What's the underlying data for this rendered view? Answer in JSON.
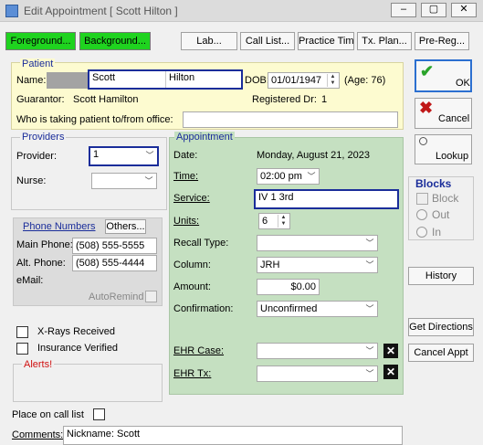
{
  "window": {
    "title": "Edit Appointment [ Scott Hilton ]",
    "minimize": "‒",
    "maximize": "▢",
    "close": "✕"
  },
  "toolbar": {
    "foreground": "Foreground...",
    "background": "Background...",
    "lab": "Lab...",
    "call_list": "Call List...",
    "practice_time": "Practice Time...",
    "tx_plan": "Tx. Plan...",
    "pre_reg": "Pre-Reg..."
  },
  "patient": {
    "group": "Patient",
    "name_label": "Name:",
    "first": "Scott",
    "last": "Hilton",
    "dob_label": "DOB:",
    "dob": "01/01/1947",
    "age": "(Age: 76)",
    "guarantor_label": "Guarantor:",
    "guarantor": "Scott Hamilton",
    "registered_label": "Registered Dr:",
    "registered_value": "1",
    "transport_label": "Who is taking patient to/from office:",
    "transport_value": ""
  },
  "providers": {
    "group": "Providers",
    "provider_label": "Provider:",
    "provider_value": "1",
    "nurse_label": "Nurse:",
    "nurse_value": ""
  },
  "phones": {
    "group": "Phone Numbers",
    "others": "Others...",
    "main_label": "Main Phone:",
    "main_value": "(508) 555-5555",
    "alt_label": "Alt. Phone:",
    "alt_value": "(508) 555-4444",
    "email_label": "eMail:",
    "autoremind": "AutoRemind"
  },
  "checks": {
    "xrays": "X-Rays Received",
    "insurance": "Insurance Verified",
    "alerts": "Alerts!",
    "call_list": "Place on call list"
  },
  "comments": {
    "label": "Comments:",
    "value": "Nickname: Scott"
  },
  "appointment": {
    "group": "Appointment",
    "date_label": "Date:",
    "date_value": "Monday, August 21, 2023",
    "time_label": "Time:",
    "time_value": "02:00 pm",
    "service_label": "Service:",
    "service_value": "IV 1 3rd",
    "units_label": "Units:",
    "units_value": "6",
    "recall_label": "Recall Type:",
    "recall_value": "",
    "column_label": "Column:",
    "column_value": "JRH",
    "amount_label": "Amount:",
    "amount_value": "$0.00",
    "confirm_label": "Confirmation:",
    "confirm_value": "Unconfirmed",
    "ehr_case_label": "EHR Case:",
    "ehr_case_value": "",
    "ehr_tx_label": "EHR Tx:",
    "ehr_tx_value": ""
  },
  "side": {
    "ok": "OK",
    "cancel": "Cancel",
    "lookup": "Lookup",
    "blocks_title": "Blocks",
    "block": "Block",
    "out": "Out",
    "in": "In",
    "history": "History",
    "directions": "Get Directions",
    "cancel_appt": "Cancel Appt"
  },
  "colors": {
    "green_button": "#1fd31f",
    "patient_panel": "#fdfbd0",
    "appointment_panel": "#c5e0c1",
    "focus_border": "#1a2d9a"
  }
}
